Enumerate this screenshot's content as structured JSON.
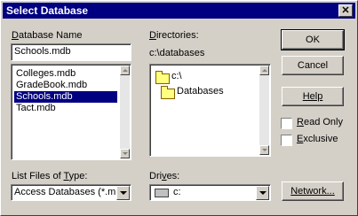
{
  "dialog": {
    "title": "Select Database",
    "close_glyph": "✕"
  },
  "database_name": {
    "label_u": "D",
    "label_rest": "atabase Name",
    "value": "Schools.mdb",
    "files": [
      "Colleges.mdb",
      "GradeBook.mdb",
      "Schools.mdb",
      "Tact.mdb"
    ],
    "selected_index": 2
  },
  "directories": {
    "label_u": "D",
    "label_rest": "irectories:",
    "current_path": "c:\\databases",
    "tree": [
      "c:\\",
      "Databases"
    ]
  },
  "file_type": {
    "label_a": "List Files of ",
    "label_u": "T",
    "label_b": "ype:",
    "value": "Access Databases (*.mc"
  },
  "drives": {
    "label_a": "Dri",
    "label_u": "v",
    "label_b": "es:",
    "value": "c:"
  },
  "buttons": {
    "ok": "OK",
    "cancel": "Cancel",
    "help": "Help",
    "network": "Network..."
  },
  "options": {
    "read_only_u": "R",
    "read_only_rest": "ead Only",
    "exclusive_u": "E",
    "exclusive_rest": "xclusive",
    "read_only_checked": false,
    "exclusive_checked": false
  },
  "colors": {
    "titlebar": "#000080",
    "face": "#d4d0c8",
    "selection": "#000080"
  }
}
